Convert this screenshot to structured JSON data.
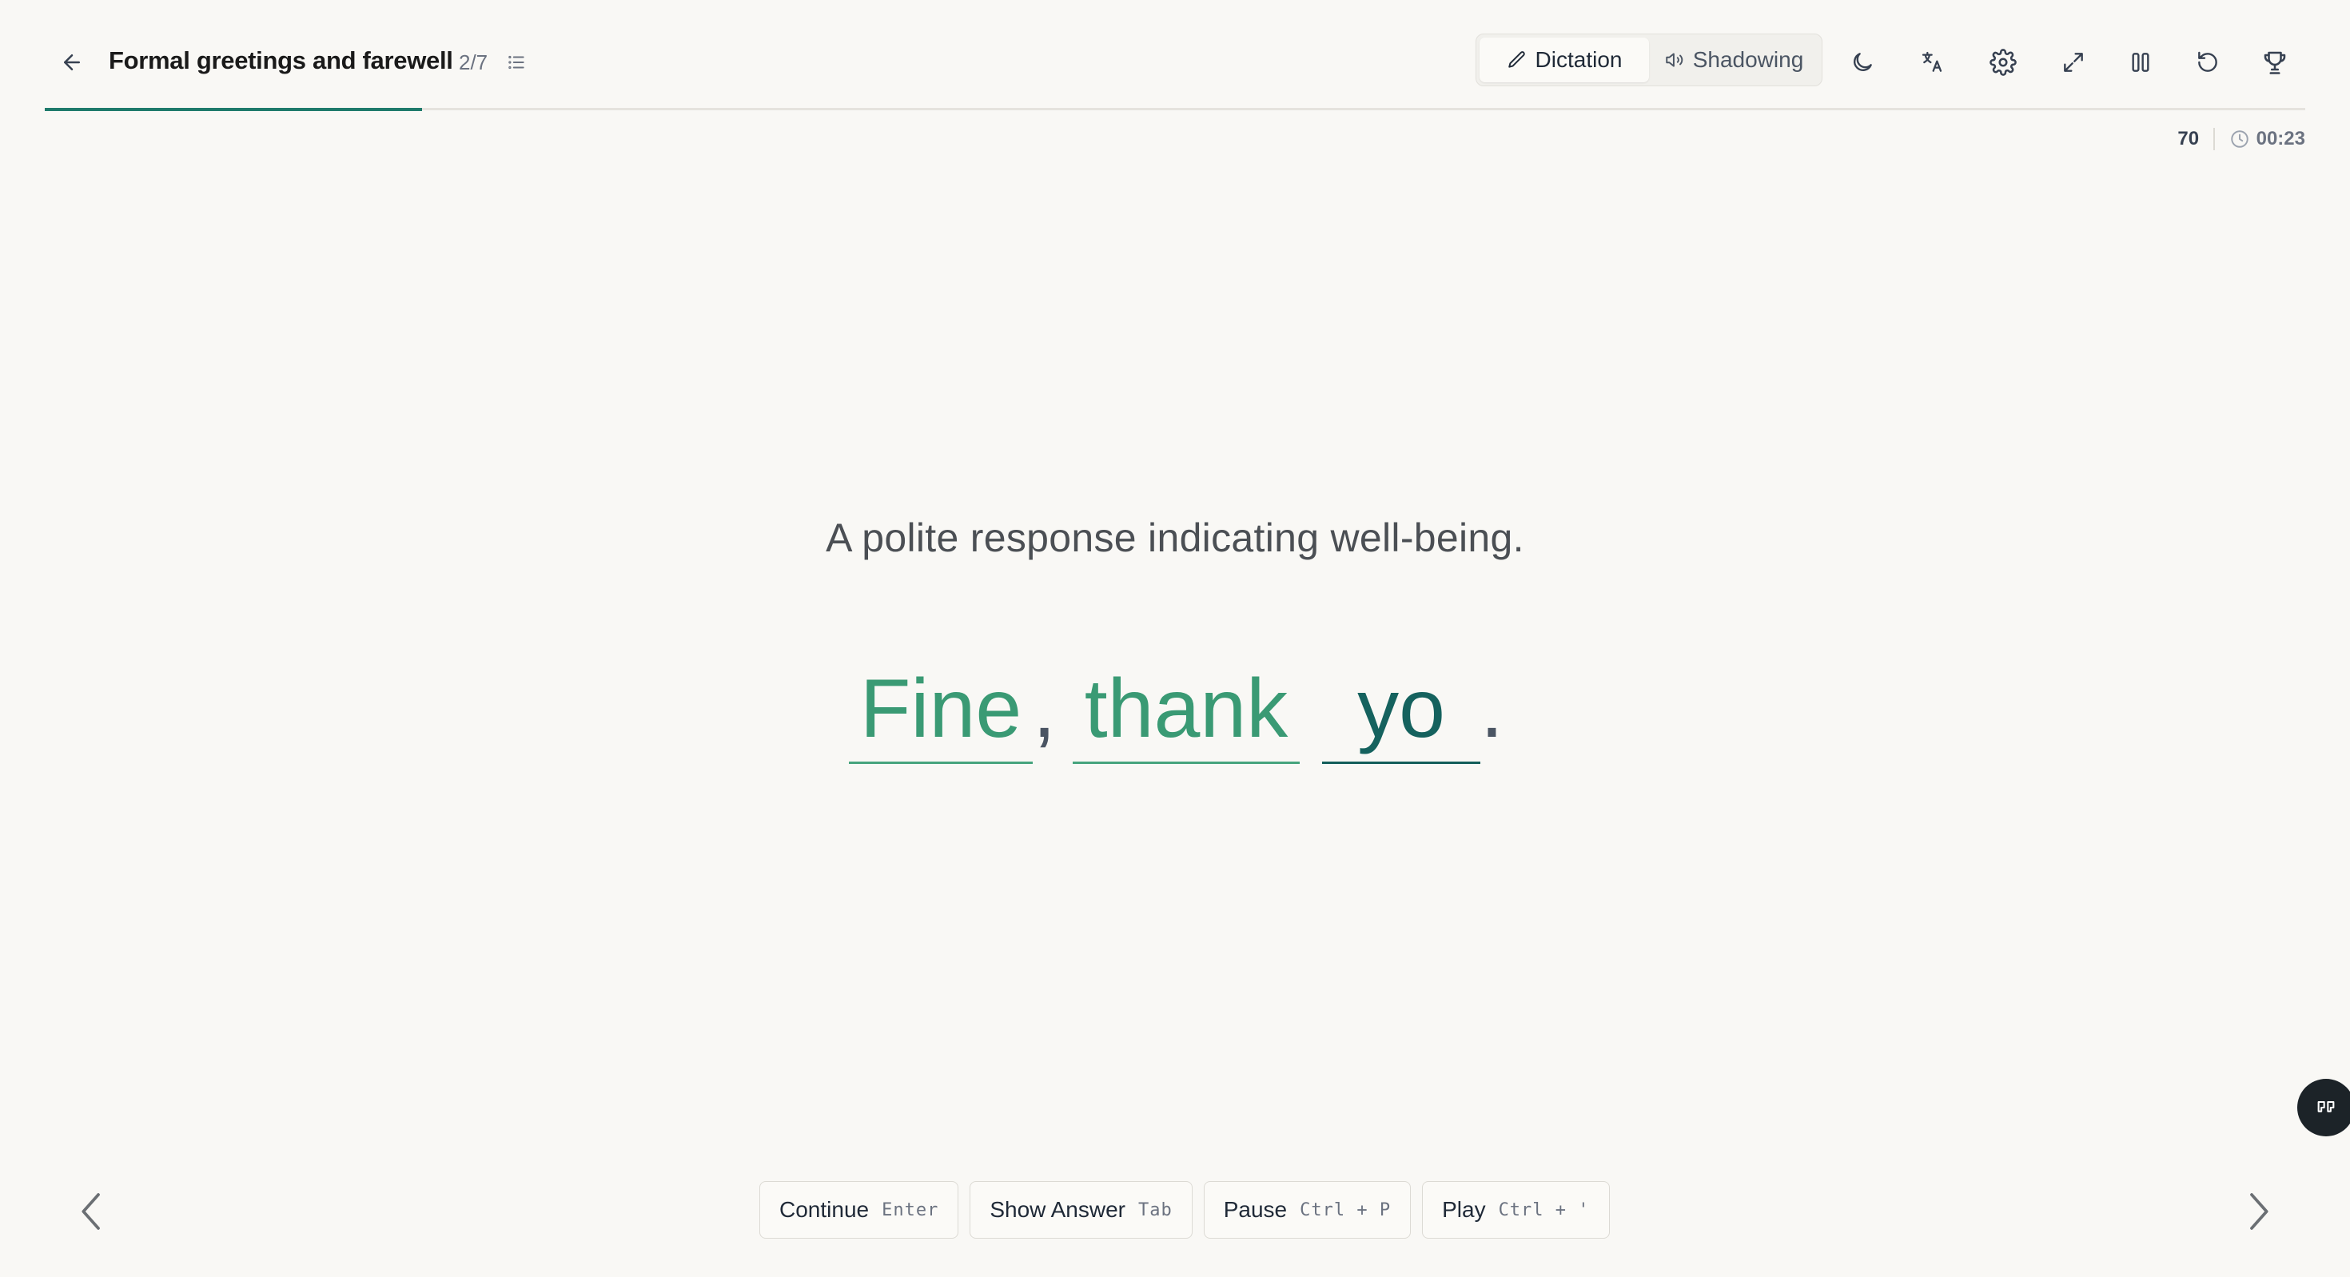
{
  "header": {
    "title": "Formal greetings and farewell",
    "counter": "2/7"
  },
  "modes": {
    "dictation": "Dictation",
    "shadowing": "Shadowing",
    "active": "dictation"
  },
  "toolbar": {
    "icons": [
      "moon-icon",
      "translate-icon",
      "gear-icon",
      "expand-icon",
      "columns-icon",
      "reset-icon",
      "trophy-icon"
    ]
  },
  "progress": {
    "value": 0.167
  },
  "stats": {
    "score": "70",
    "time": "00:23"
  },
  "exercise": {
    "hint": "A polite response indicating well-being.",
    "words": [
      {
        "text": "Fine",
        "state": "correct"
      },
      {
        "text": "thank",
        "state": "correct"
      },
      {
        "text": "yo",
        "state": "active"
      }
    ],
    "punctuation": [
      ",",
      "."
    ]
  },
  "actions": [
    {
      "label": "Continue",
      "key": "Enter"
    },
    {
      "label": "Show Answer",
      "key": "Tab"
    },
    {
      "label": "Pause",
      "key": "Ctrl + P"
    },
    {
      "label": "Play",
      "key": "Ctrl + '"
    }
  ],
  "colors": {
    "accent": "#1f7a6b",
    "correct": "#3a9a74",
    "active": "#15625e",
    "background": "#f9f8f5"
  }
}
